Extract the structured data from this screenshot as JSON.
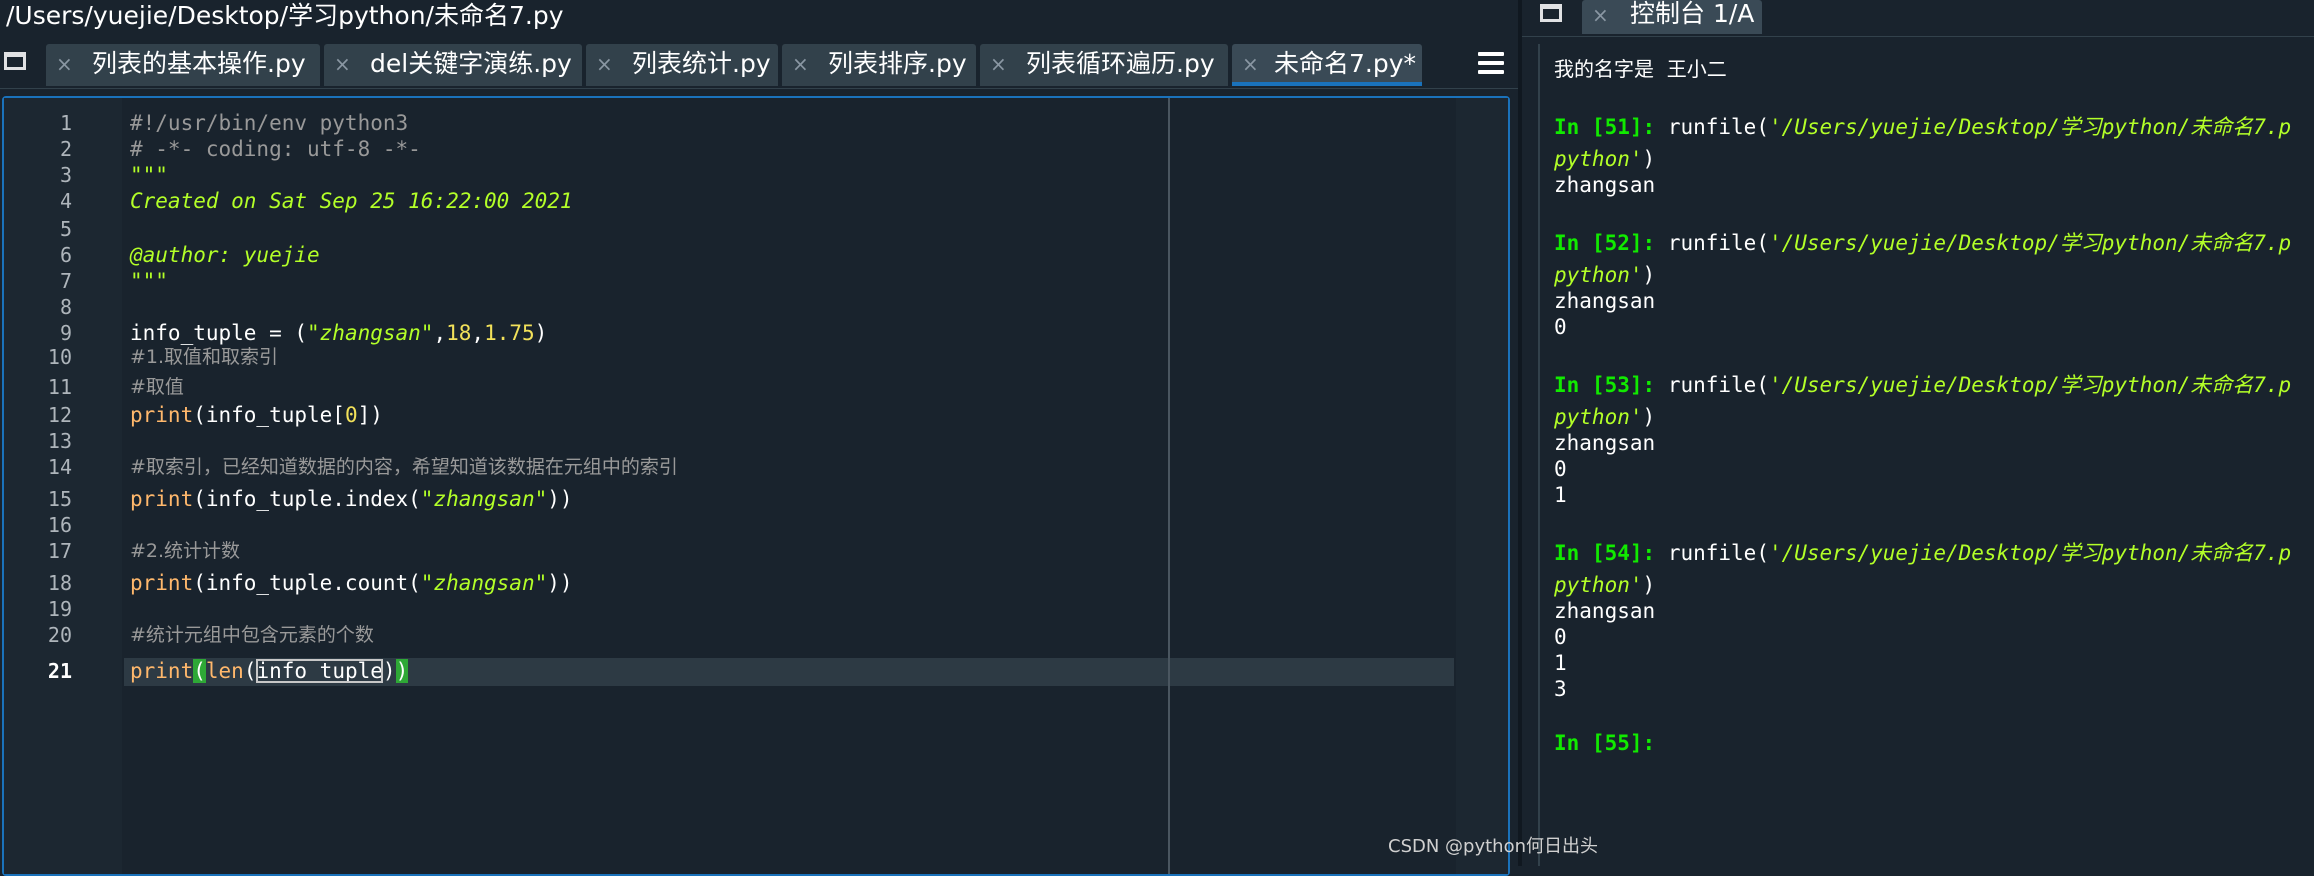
{
  "editor": {
    "file_path": "/Users/yuejie/Desktop/学习python/未命名7.py",
    "tabs": [
      {
        "label": "列表的基本操作.py",
        "close": "×",
        "active": false
      },
      {
        "label": "del关键字演练.py",
        "close": "×",
        "active": false
      },
      {
        "label": "列表统计.py",
        "close": "×",
        "active": false
      },
      {
        "label": "列表排序.py",
        "close": "×",
        "active": false
      },
      {
        "label": "列表循环遍历.py",
        "close": "×",
        "active": false
      },
      {
        "label": "未命名7.py*",
        "close": "×",
        "active": true
      }
    ],
    "line_numbers": [
      "1",
      "2",
      "3",
      "4",
      "5",
      "6",
      "7",
      "8",
      "9",
      "10",
      "11",
      "12",
      "13",
      "14",
      "15",
      "16",
      "17",
      "18",
      "19",
      "20",
      "21"
    ],
    "current_line": "21",
    "code": {
      "l1": "#!/usr/bin/env python3",
      "l2": "# -*- coding: utf-8 -*-",
      "l3": "\"\"\"",
      "l4": "Created on Sat Sep 25 16:22:00 2021",
      "l6": "@author: yuejie",
      "l7": "\"\"\"",
      "l9_a": "info_tuple = (",
      "l9_s": "\"zhangsan\"",
      "l9_c1": ",",
      "l9_n1": "18",
      "l9_c2": ",",
      "l9_n2": "1.75",
      "l9_e": ")",
      "l10": "#1.取值和取索引",
      "l11": "#取值",
      "l12_kw": "print",
      "l12_a": "(info_tuple[",
      "l12_n": "0",
      "l12_e": "])",
      "l14": "#取索引，已经知道数据的内容，希望知道该数据在元组中的索引",
      "l15_kw": "print",
      "l15_a": "(info_tuple.index(",
      "l15_s": "\"zhangsan\"",
      "l15_e": "))",
      "l17": "#2.统计计数",
      "l18_kw": "print",
      "l18_a": "(info_tuple.count(",
      "l18_s": "\"zhangsan\"",
      "l18_e": "))",
      "l20": "#统计元组中包含元素的个数",
      "l21_kw": "print",
      "l21_p1": "(",
      "l21_kw2": "len",
      "l21_p2": "(",
      "l21_arg": "info_tuple",
      "l21_p3": ")",
      "l21_p4": ")"
    }
  },
  "console": {
    "tab_label": "控制台 1/A",
    "tab_close": "×",
    "first_output": "我的名字是  王小二",
    "prompt_in": "In [",
    "prompt_end": "]: ",
    "runfile_call": "runfile(",
    "runfile_path": "'/Users/yuejie/Desktop/学习python/未命名7.p",
    "runfile_path_cont": "python'",
    "close_paren": ")",
    "blocks": [
      {
        "num": "51",
        "outputs": [
          "zhangsan"
        ]
      },
      {
        "num": "52",
        "outputs": [
          "zhangsan",
          "0"
        ]
      },
      {
        "num": "53",
        "outputs": [
          "zhangsan",
          "0",
          "1"
        ]
      },
      {
        "num": "54",
        "outputs": [
          "zhangsan",
          "0",
          "1",
          "3"
        ]
      }
    ],
    "last_prompt_num": "55"
  },
  "watermark": "CSDN @python何日出头",
  "colors": {
    "background": "#19232d",
    "accent": "#1a72bb",
    "prompt_green": "#11ea00",
    "string_green": "#b3ff28",
    "keyword_orange": "#ffb86c",
    "number_yellow": "#f2e15a"
  }
}
